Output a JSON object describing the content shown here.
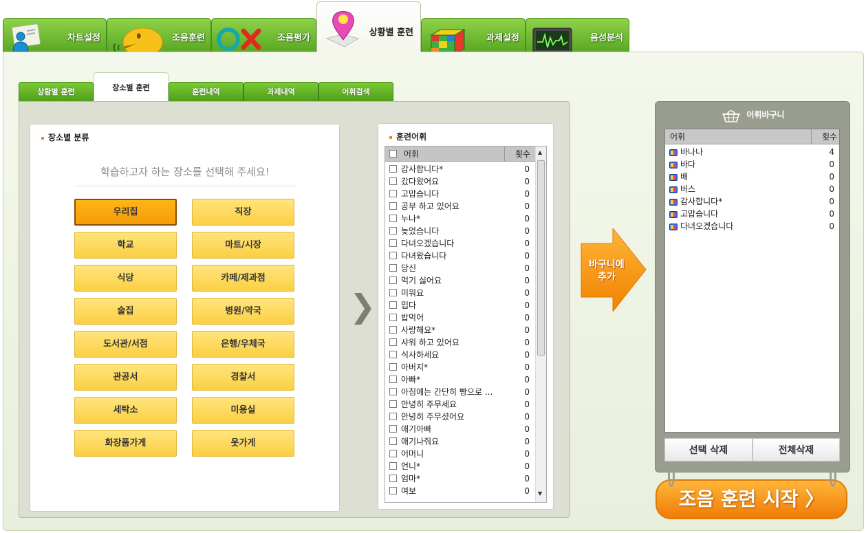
{
  "top_tabs": [
    {
      "label": "차트설정",
      "icon": "user-card-icon"
    },
    {
      "label": "조음훈련",
      "icon": "speaking-face-icon"
    },
    {
      "label": "조음평가",
      "icon": "ox-icon"
    },
    {
      "label": "상황별 훈련",
      "icon": "map-pin-icon",
      "active": true
    },
    {
      "label": "과제설정",
      "icon": "cube-icon"
    },
    {
      "label": "음성분석",
      "icon": "waveform-monitor-icon"
    }
  ],
  "sub_tabs": [
    {
      "label": "상황별 훈련"
    },
    {
      "label": "장소별 훈련",
      "active": true
    },
    {
      "label": "훈련내역"
    },
    {
      "label": "과제내역"
    },
    {
      "label": "어휘검색"
    }
  ],
  "place_panel": {
    "title": "장소별 분류",
    "instruction": "학습하고자 하는 장소를 선택해 주세요!",
    "places": [
      "우리집",
      "직장",
      "학교",
      "마트/시장",
      "식당",
      "카페/제과점",
      "술집",
      "병원/약국",
      "도서관/서점",
      "은행/우체국",
      "관공서",
      "경찰서",
      "세탁소",
      "미용실",
      "화장품가게",
      "옷가게"
    ],
    "selected": "우리집"
  },
  "vocab_panel": {
    "title": "훈련어휘",
    "col_word": "어휘",
    "col_count": "횟수",
    "items": [
      {
        "word": "감사합니다*",
        "count": "0"
      },
      {
        "word": "갔다왔어요",
        "count": "0"
      },
      {
        "word": "고맙습니다",
        "count": "0"
      },
      {
        "word": "공부 하고 있어요",
        "count": "0"
      },
      {
        "word": "누나*",
        "count": "0"
      },
      {
        "word": "늦었습니다",
        "count": "0"
      },
      {
        "word": "다녀오겠습니다",
        "count": "0"
      },
      {
        "word": "다녀왔습니다",
        "count": "0"
      },
      {
        "word": "당신",
        "count": "0"
      },
      {
        "word": "먹기 싫어요",
        "count": "0"
      },
      {
        "word": "미워요",
        "count": "0"
      },
      {
        "word": "밉다",
        "count": "0"
      },
      {
        "word": "밥먹어",
        "count": "0"
      },
      {
        "word": "사랑해요*",
        "count": "0"
      },
      {
        "word": "샤워 하고 있어요",
        "count": "0"
      },
      {
        "word": "식사하세요",
        "count": "0"
      },
      {
        "word": "아버지*",
        "count": "0"
      },
      {
        "word": "아빠*",
        "count": "0"
      },
      {
        "word": "아침에는 간단히 빵으로 ...",
        "count": "0"
      },
      {
        "word": "안녕히 주무세요",
        "count": "0"
      },
      {
        "word": "안녕히 주무셨어요",
        "count": "0"
      },
      {
        "word": "애기아빠",
        "count": "0"
      },
      {
        "word": "애기나줘요",
        "count": "0"
      },
      {
        "word": "어머니",
        "count": "0"
      },
      {
        "word": "언니*",
        "count": "0"
      },
      {
        "word": "엄마*",
        "count": "0"
      },
      {
        "word": "여보",
        "count": "0"
      }
    ]
  },
  "add_button": {
    "label_line1": "바구니에",
    "label_line2": "추가"
  },
  "basket": {
    "title": "어휘바구니",
    "col_word": "어휘",
    "col_count": "횟수",
    "items": [
      {
        "word": "바나나",
        "count": "4"
      },
      {
        "word": "바다",
        "count": "0"
      },
      {
        "word": "배",
        "count": "0"
      },
      {
        "word": "버스",
        "count": "0"
      },
      {
        "word": "감사합니다*",
        "count": "0"
      },
      {
        "word": "고맙습니다",
        "count": "0"
      },
      {
        "word": "다녀오겠습니다",
        "count": "0"
      }
    ],
    "delete_selected": "선택 삭제",
    "delete_all": "전체삭제"
  },
  "start_button": {
    "label": "조음 훈련 시작 〉"
  },
  "colors": {
    "accent_green": "#5aa723",
    "place_button": "#fbcf43",
    "place_selected": "#f59d06",
    "start_orange": "#f07c06"
  }
}
